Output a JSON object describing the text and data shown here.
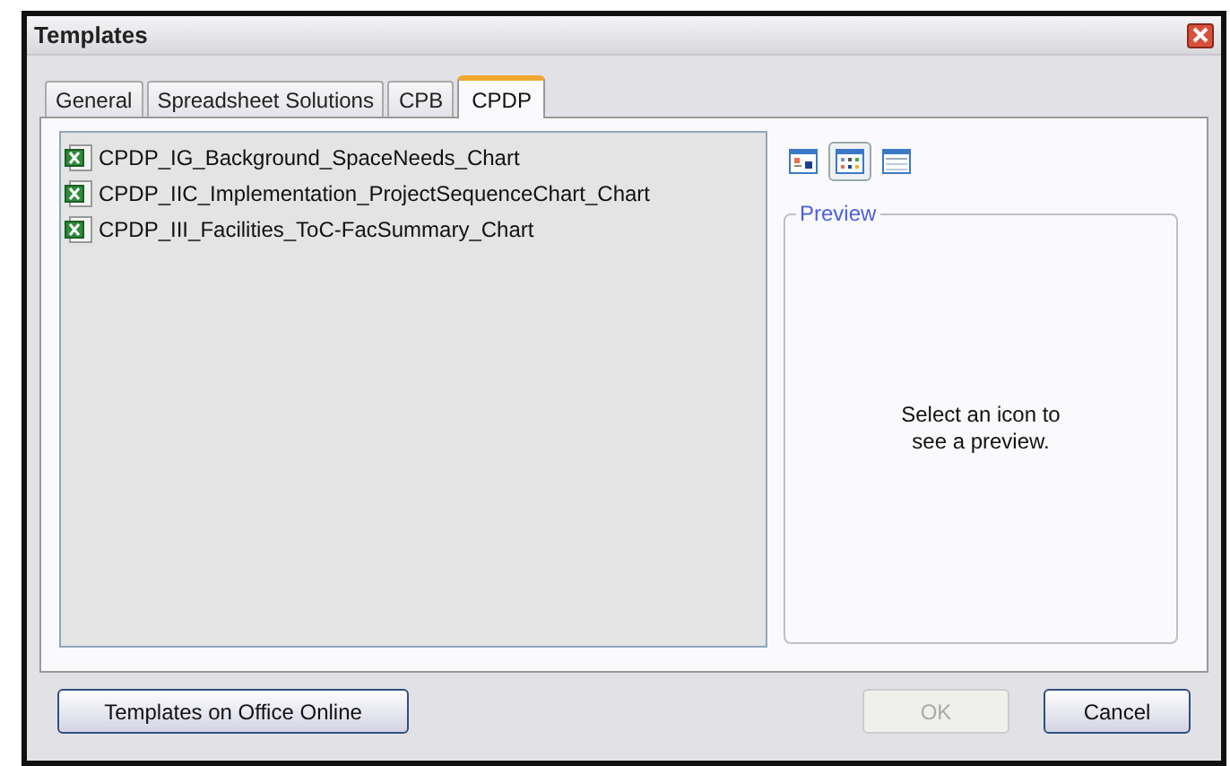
{
  "window": {
    "title": "Templates"
  },
  "tabs": [
    {
      "label": "General",
      "selected": false
    },
    {
      "label": "Spreadsheet Solutions",
      "selected": false
    },
    {
      "label": "CPB",
      "selected": false
    },
    {
      "label": "CPDP",
      "selected": true
    }
  ],
  "files": [
    {
      "name": "CPDP_IG_Background_SpaceNeeds_Chart"
    },
    {
      "name": "CPDP_IIC_Implementation_ProjectSequenceChart_Chart"
    },
    {
      "name": "CPDP_III_Facilities_ToC-FacSummary_Chart"
    }
  ],
  "view_buttons": [
    {
      "kind": "large",
      "selected": false
    },
    {
      "kind": "list",
      "selected": true
    },
    {
      "kind": "details",
      "selected": false
    }
  ],
  "preview": {
    "title": "Preview",
    "message": "Select an icon to see a preview."
  },
  "buttons": [
    {
      "label": "Templates on Office Online",
      "disabled": false
    },
    {
      "label": "OK",
      "disabled": true
    },
    {
      "label": "Cancel",
      "disabled": false
    }
  ]
}
